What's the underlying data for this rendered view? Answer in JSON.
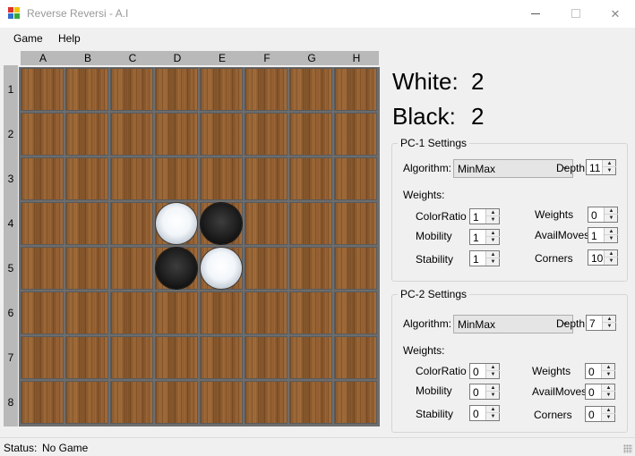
{
  "window": {
    "title": "Reverse Reversi - A.I",
    "minimize_glyph": "—",
    "maximize_glyph": "☐",
    "close_glyph": "✕"
  },
  "menu": {
    "game": "Game",
    "help": "Help"
  },
  "board": {
    "columns": [
      "A",
      "B",
      "C",
      "D",
      "E",
      "F",
      "G",
      "H"
    ],
    "rows": [
      "1",
      "2",
      "3",
      "4",
      "5",
      "6",
      "7",
      "8"
    ],
    "pieces": [
      {
        "cell": "D4",
        "color": "white"
      },
      {
        "cell": "E4",
        "color": "black"
      },
      {
        "cell": "D5",
        "color": "black"
      },
      {
        "cell": "E5",
        "color": "white"
      }
    ]
  },
  "scores": {
    "white_label": "White:",
    "white_value": "2",
    "black_label": "Black:",
    "black_value": "2"
  },
  "pc1": {
    "title": "PC-1 Settings",
    "algorithm_label": "Algorithm:",
    "algorithm_value": "MinMax",
    "depth_label": "Depth:",
    "depth_value": "11",
    "weights_label": "Weights:",
    "color_ratio_label": "ColorRatio",
    "color_ratio_value": "1",
    "mobility_label": "Mobility",
    "mobility_value": "1",
    "stability_label": "Stability",
    "stability_value": "1",
    "weights_field_label": "Weights",
    "weights_field_value": "0",
    "avail_moves_label": "AvailMoves",
    "avail_moves_value": "1",
    "corners_label": "Corners",
    "corners_value": "10"
  },
  "pc2": {
    "title": "PC-2 Settings",
    "algorithm_label": "Algorithm:",
    "algorithm_value": "MinMax",
    "depth_label": "Depth:",
    "depth_value": "7",
    "weights_label": "Weights:",
    "color_ratio_label": "ColorRatio",
    "color_ratio_value": "0",
    "mobility_label": "Mobility",
    "mobility_value": "0",
    "stability_label": "Stability",
    "stability_value": "0",
    "weights_field_label": "Weights",
    "weights_field_value": "0",
    "avail_moves_label": "AvailMoves",
    "avail_moves_value": "0",
    "corners_label": "Corners",
    "corners_value": "0"
  },
  "status": {
    "label": "Status:",
    "value": "No Game"
  },
  "colors": {
    "title_text": "#999999",
    "col_header": "#b9b9b9",
    "wood": "#8a5a2e"
  }
}
